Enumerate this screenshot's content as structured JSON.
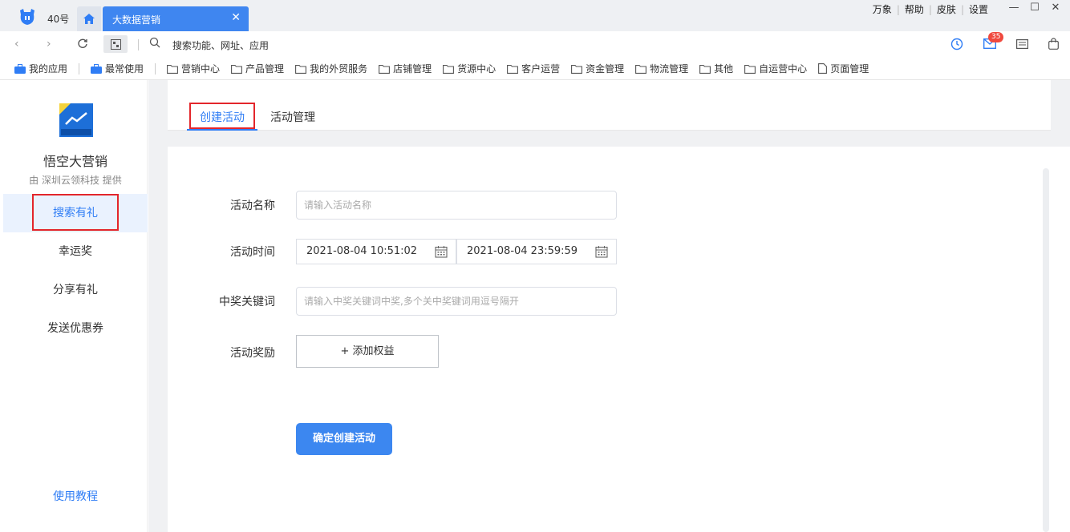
{
  "titlebar": {
    "account": "40号",
    "active_tab": "大数据营销",
    "menu": [
      "万象",
      "帮助",
      "皮肤",
      "设置"
    ]
  },
  "navbar": {
    "search_placeholder": "搜索功能、网址、应用",
    "mail_badge": "35"
  },
  "bookmarks": [
    {
      "label": "我的应用",
      "icon": "briefcase-icon"
    },
    {
      "label": "最常使用",
      "icon": "briefcase-icon"
    },
    {
      "label": "营销中心",
      "icon": "folder-icon"
    },
    {
      "label": "产品管理",
      "icon": "folder-icon"
    },
    {
      "label": "我的外贸服务",
      "icon": "folder-icon"
    },
    {
      "label": "店铺管理",
      "icon": "folder-icon"
    },
    {
      "label": "货源中心",
      "icon": "folder-icon"
    },
    {
      "label": "客户运营",
      "icon": "folder-icon"
    },
    {
      "label": "资金管理",
      "icon": "folder-icon"
    },
    {
      "label": "物流管理",
      "icon": "folder-icon"
    },
    {
      "label": "其他",
      "icon": "folder-icon"
    },
    {
      "label": "自运营中心",
      "icon": "folder-icon"
    },
    {
      "label": "页面管理",
      "icon": "page-icon"
    }
  ],
  "sidebar": {
    "app_name": "悟空大营销",
    "provider": "由 深圳云领科技 提供",
    "items": [
      {
        "label": "搜索有礼",
        "active": true
      },
      {
        "label": "幸运奖",
        "active": false
      },
      {
        "label": "分享有礼",
        "active": false
      },
      {
        "label": "发送优惠券",
        "active": false
      }
    ],
    "tutorial": "使用教程"
  },
  "content": {
    "tabs": [
      {
        "label": "创建活动",
        "active": true
      },
      {
        "label": "活动管理",
        "active": false
      }
    ]
  },
  "form": {
    "name_label": "活动名称",
    "name_placeholder": "请输入活动名称",
    "time_label": "活动时间",
    "start_time": "2021-08-04 10:51:02",
    "end_time": "2021-08-04 23:59:59",
    "keyword_label": "中奖关键词",
    "keyword_placeholder": "请输入中奖关键词中奖,多个关中奖键词用逗号隔开",
    "reward_label": "活动奖励",
    "add_reward": "+ 添加权益",
    "submit": "确定创建活动"
  },
  "colors": {
    "accent": "#2f7df5",
    "highlight_box": "#e3262b",
    "tab_active_bg": "#3f86f0"
  }
}
